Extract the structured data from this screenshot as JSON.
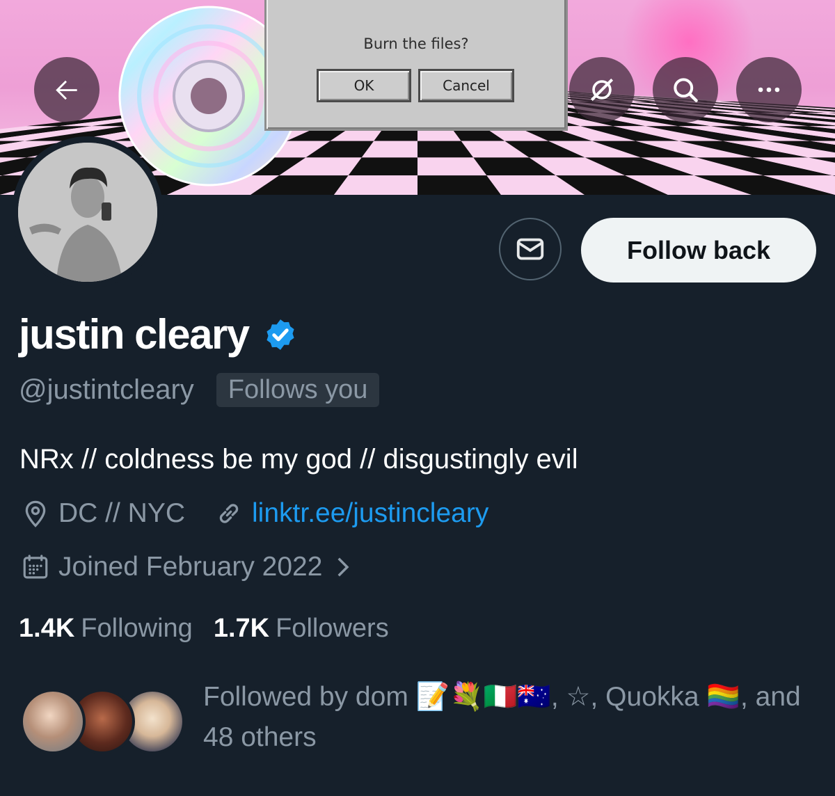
{
  "banner": {
    "dialog_message": "Burn the files?",
    "ok_label": "OK",
    "cancel_label": "Cancel"
  },
  "header": {
    "back_icon": "back-arrow-icon",
    "grok_icon": "grok-icon",
    "search_icon": "search-icon",
    "more_icon": "more-icon"
  },
  "actions": {
    "message_icon": "envelope-icon",
    "follow_label": "Follow back"
  },
  "profile": {
    "name": "justin cleary",
    "verified": true,
    "handle": "@justintcleary",
    "follows_you_label": "Follows you",
    "bio": "NRx // coldness be my god // disgustingly evil",
    "location": "DC // NYC",
    "link": "linktr.ee/justincleary",
    "joined": "Joined February 2022"
  },
  "stats": {
    "following_count": "1.4K",
    "following_label": "Following",
    "followers_count": "1.7K",
    "followers_label": "Followers"
  },
  "followed_by": {
    "text": "Followed by dom 📝💐🇮🇹🇦🇺, ☆, Quokka 🏳️‍🌈, and 48 others"
  },
  "colors": {
    "background": "#16202b",
    "accent_link": "#1d9bf0",
    "muted_text": "#8b98a5",
    "verified_badge": "#1d9bf0"
  }
}
